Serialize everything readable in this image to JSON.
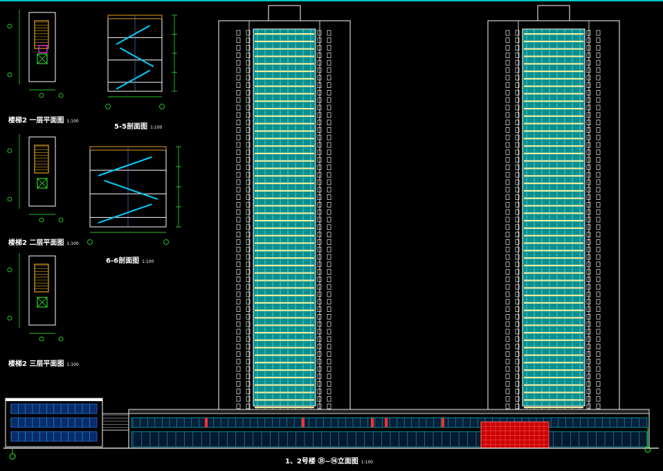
{
  "plans": [
    {
      "title": "楼梯2 一层平面图",
      "scale": "1:100"
    },
    {
      "title": "楼梯2 二层平面图",
      "scale": "1:100"
    },
    {
      "title": "楼梯2 三层平面图",
      "scale": "1:100"
    }
  ],
  "sections": [
    {
      "title": "5-5剖面图",
      "scale": "1:100"
    },
    {
      "title": "6-6剖面图",
      "scale": "1:100"
    }
  ],
  "elevation": {
    "title": "1、2号楼 ㉛~⑭立面图",
    "scale": "1:100"
  },
  "colors": {
    "glass": "#0a8f8f",
    "window_light": "#f0f0a0",
    "outline": "#ffffff",
    "podium_glass": "#00b0c0",
    "red_panel": "#cc0000",
    "plan_stair": "#e0a020",
    "plan_green": "#30ff30",
    "section_stair": "#00d0ff"
  }
}
